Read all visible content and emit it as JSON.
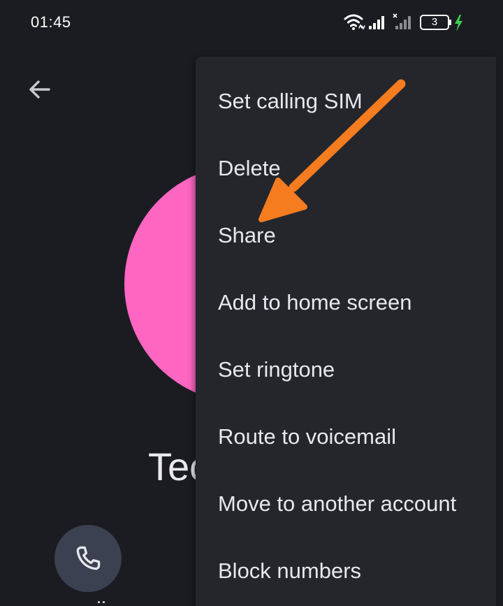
{
  "status_bar": {
    "time": "01:45",
    "battery_level": "3",
    "icons": [
      "wifi-icon",
      "signal-icon",
      "signal-no-sim-icon",
      "battery-icon",
      "charging-bolt-icon"
    ]
  },
  "toolbar": {
    "back_icon": "arrow-left-icon"
  },
  "contact": {
    "name_visible": "Tec",
    "avatar_color": "#ff66c2"
  },
  "actions": {
    "call_icon": "phone-icon"
  },
  "overflow_menu": {
    "items": [
      {
        "label": "Set calling SIM"
      },
      {
        "label": "Delete"
      },
      {
        "label": "Share"
      },
      {
        "label": "Add to home screen"
      },
      {
        "label": "Set ringtone"
      },
      {
        "label": "Route to voicemail"
      },
      {
        "label": "Move to another account"
      },
      {
        "label": "Block numbers"
      }
    ]
  },
  "annotation": {
    "arrow_color": "#f57c1f",
    "points_to": "Share"
  },
  "colors": {
    "background": "#1b1c21",
    "menu_background": "#24262c",
    "call_button": "#3b4150",
    "charging": "#3ecf4e"
  }
}
